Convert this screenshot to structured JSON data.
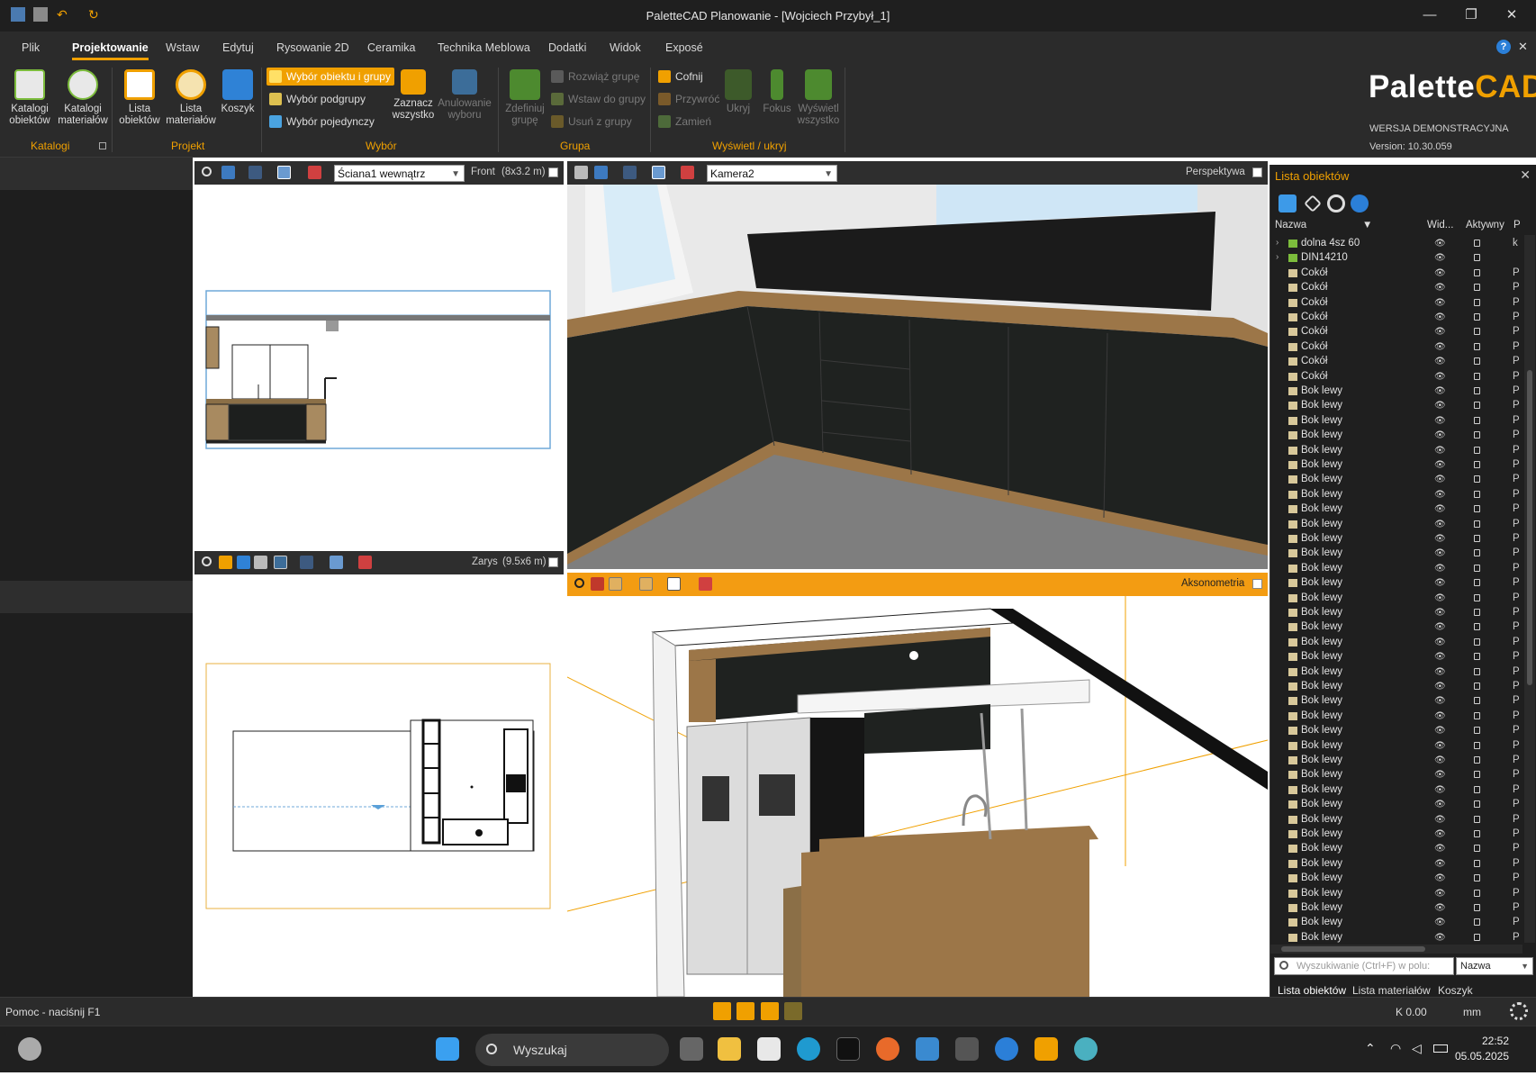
{
  "window": {
    "title": "PaletteCAD Planowanie - [Wojciech Przybył_1]",
    "controls": [
      "—",
      "❐",
      "✕"
    ]
  },
  "menu": {
    "tabs": [
      "Plik",
      "Projektowanie",
      "Wstaw",
      "Edytuj",
      "Rysowanie 2D",
      "Ceramika",
      "Technika Meblowa",
      "Dodatki",
      "Widok",
      "Exposé"
    ],
    "active": "Projektowanie",
    "help": "?",
    "close": "✕"
  },
  "ribbon": {
    "katalogi_obiektow": "Katalogi obiektów",
    "katalogi_materialow": "Katalogi materiałów",
    "lista_obiektow": "Lista obiektów",
    "lista_materialow": "Lista materiałów",
    "koszyk": "Koszyk",
    "wybor_obiektu": "Wybór obiektu i grupy",
    "wybor_podgrupy": "Wybór podgrupy",
    "wybor_pojedynczy": "Wybór pojedynczy",
    "zaznacz_wszystko": "Zaznacz wszystko",
    "anulowanie_wyboru": "Anulowanie wyboru",
    "zdefiniuj_grupe": "Zdefiniuj grupę",
    "rozwiaz_grupe": "Rozwiąż grupę",
    "wstaw_do_grupy": "Wstaw do grupy",
    "usun_z_grupy": "Usuń z grupy",
    "cofnij": "Cofnij",
    "przywroc": "Przywróć",
    "zamien": "Zamień",
    "ukryj": "Ukryj",
    "fokus": "Fokus",
    "wyswietl_wszystko": "Wyświetl wszystko",
    "groups": {
      "katalogi": "Katalogi",
      "projekt": "Projekt",
      "wybor": "Wybór",
      "grupa": "Grupa",
      "wyswietl": "Wyświetl / ukryj"
    },
    "logo_main": "Palette",
    "logo_accent": "CAD",
    "demo_text": "WERSJA DEMONSTRACYJNA",
    "version": "Version: 10.30.059"
  },
  "views": {
    "front": {
      "select": "Ściana1 wewnątrz",
      "label": "Front",
      "size": "(8x3.2 m)"
    },
    "camera": {
      "select": "Kamera2",
      "label": "Perspektywa"
    },
    "outline": {
      "label": "Zarys",
      "size": "(9.5x6 m)"
    },
    "axo": {
      "label": "Aksonometria"
    }
  },
  "object_list": {
    "title": "Lista obiektów",
    "columns": {
      "name": "Nazwa",
      "visible": "Wid...",
      "active": "Aktywny",
      "p": "P"
    },
    "rows": [
      {
        "name": "dolna 4sz 60",
        "p": "k",
        "expand": true
      },
      {
        "name": "DIN14210",
        "p": "",
        "expand": true
      },
      {
        "name": "Cokół",
        "p": "P"
      },
      {
        "name": "Cokół",
        "p": "P"
      },
      {
        "name": "Cokół",
        "p": "P"
      },
      {
        "name": "Cokół",
        "p": "P"
      },
      {
        "name": "Cokół",
        "p": "P"
      },
      {
        "name": "Cokół",
        "p": "P"
      },
      {
        "name": "Cokół",
        "p": "P"
      },
      {
        "name": "Cokół",
        "p": "P"
      },
      {
        "name": "Bok lewy",
        "p": "P"
      },
      {
        "name": "Bok lewy",
        "p": "P"
      },
      {
        "name": "Bok lewy",
        "p": "P"
      },
      {
        "name": "Bok lewy",
        "p": "P"
      },
      {
        "name": "Bok lewy",
        "p": "P"
      },
      {
        "name": "Bok lewy",
        "p": "P"
      },
      {
        "name": "Bok lewy",
        "p": "P"
      },
      {
        "name": "Bok lewy",
        "p": "P"
      },
      {
        "name": "Bok lewy",
        "p": "P"
      },
      {
        "name": "Bok lewy",
        "p": "P"
      },
      {
        "name": "Bok lewy",
        "p": "P"
      },
      {
        "name": "Bok lewy",
        "p": "P"
      },
      {
        "name": "Bok lewy",
        "p": "P"
      },
      {
        "name": "Bok lewy",
        "p": "P"
      },
      {
        "name": "Bok lewy",
        "p": "P"
      },
      {
        "name": "Bok lewy",
        "p": "P"
      },
      {
        "name": "Bok lewy",
        "p": "P"
      },
      {
        "name": "Bok lewy",
        "p": "P"
      },
      {
        "name": "Bok lewy",
        "p": "P"
      },
      {
        "name": "Bok lewy",
        "p": "P"
      },
      {
        "name": "Bok lewy",
        "p": "P"
      },
      {
        "name": "Bok lewy",
        "p": "P"
      },
      {
        "name": "Bok lewy",
        "p": "P"
      },
      {
        "name": "Bok lewy",
        "p": "P"
      },
      {
        "name": "Bok lewy",
        "p": "P"
      },
      {
        "name": "Bok lewy",
        "p": "P"
      },
      {
        "name": "Bok lewy",
        "p": "P"
      },
      {
        "name": "Bok lewy",
        "p": "P"
      },
      {
        "name": "Bok lewy",
        "p": "P"
      },
      {
        "name": "Bok lewy",
        "p": "P"
      },
      {
        "name": "Bok lewy",
        "p": "P"
      },
      {
        "name": "Bok lewy",
        "p": "P"
      },
      {
        "name": "Bok lewy",
        "p": "P"
      },
      {
        "name": "Bok lewy",
        "p": "P"
      },
      {
        "name": "Bok lewy",
        "p": "P"
      },
      {
        "name": "Bok lewy",
        "p": "P"
      },
      {
        "name": "Bok lewy",
        "p": "P"
      },
      {
        "name": "Bok lewy",
        "p": "P"
      }
    ],
    "search_placeholder": "Wyszukiwanie (Ctrl+F) w polu:",
    "search_field": "Nazwa",
    "tabs": [
      "Lista obiektów",
      "Lista materiałów",
      "Koszyk"
    ]
  },
  "status": {
    "help": "Pomoc - naciśnij F1",
    "k_value": "K 0.00",
    "unit": "mm"
  },
  "taskbar": {
    "search": "Wyszukaj",
    "time": "22:52",
    "date": "05.05.2025"
  },
  "colors": {
    "accent": "#f0a000",
    "panel": "#2b2b2b",
    "dark": "#1f1f1f"
  }
}
